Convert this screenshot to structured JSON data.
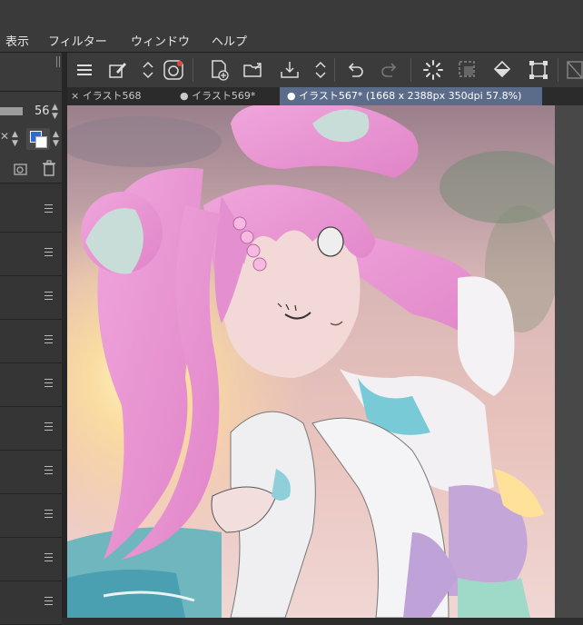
{
  "menu": {
    "items": [
      "表示",
      "フィルター",
      "ウィンドウ",
      "ヘルプ"
    ]
  },
  "left_panel": {
    "brush_size_value": "56"
  },
  "toolbar": {
    "icons": [
      "menu-icon",
      "edit-icon",
      "stepper-icon",
      "app-icon",
      "new-file-icon",
      "open-folder-icon",
      "save-icon",
      "stepper-icon",
      "undo-icon",
      "redo-icon",
      "loading-icon",
      "selection-icon",
      "fill-icon",
      "transform-icon",
      "extra-icon"
    ]
  },
  "tabs": [
    {
      "label": "× イラスト568",
      "state": "close"
    },
    {
      "label": "● イラスト569*",
      "state": "modified"
    },
    {
      "label": "● イラスト567* (1668 x 2388px 350dpi 57.8%)",
      "state": "active"
    }
  ],
  "colors": {
    "accent_tab": "#5b6b8a",
    "foreground": "#2f6ad8",
    "hair": "#e79ad2"
  }
}
